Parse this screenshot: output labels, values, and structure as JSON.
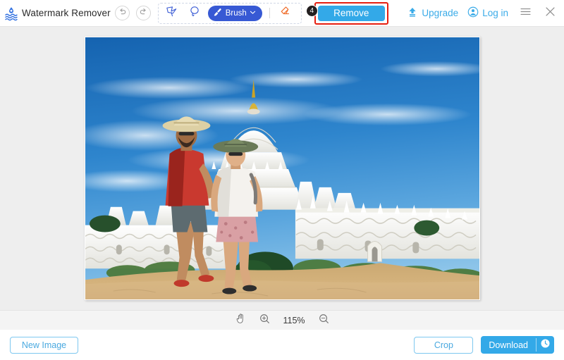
{
  "app": {
    "title": "Watermark Remover",
    "logo_icon": "water-droplet-waves-icon"
  },
  "header": {
    "history": {
      "undo_icon": "undo-arrow-icon",
      "redo_icon": "redo-arrow-icon"
    },
    "tools": {
      "polygon_lasso_icon": "polygonal-lasso-icon",
      "lasso_icon": "lasso-icon",
      "brush_label": "Brush",
      "brush_icon": "paintbrush-icon",
      "brush_chevron_icon": "chevron-down-icon",
      "eraser_icon": "eraser-icon"
    },
    "remove": {
      "label": "Remove",
      "step_badge": "4",
      "highlight_color": "#e61e10",
      "button_color": "#33a9e8"
    },
    "upgrade": {
      "label": "Upgrade",
      "icon": "upgrade-arrow-icon"
    },
    "login": {
      "label": "Log in",
      "icon": "user-avatar-icon"
    },
    "menu_icon": "hamburger-menu-icon",
    "close_icon": "close-x-icon",
    "accent_color": "#3aabe8"
  },
  "canvas": {
    "image_alt": "Two tourists walking in front of the white Hsinbyume Pagoda under a blue sky"
  },
  "zoombar": {
    "hand_tool_icon": "hand-pan-icon",
    "zoom_in_icon": "zoom-in-magnifier-icon",
    "zoom_level": "115%",
    "zoom_out_icon": "zoom-out-magnifier-icon"
  },
  "footer": {
    "new_image_label": "New Image",
    "crop_label": "Crop",
    "download_label": "Download",
    "download_history_icon": "clock-history-icon",
    "primary_color": "#33a9e8",
    "outline_color": "#7ec8f0"
  }
}
